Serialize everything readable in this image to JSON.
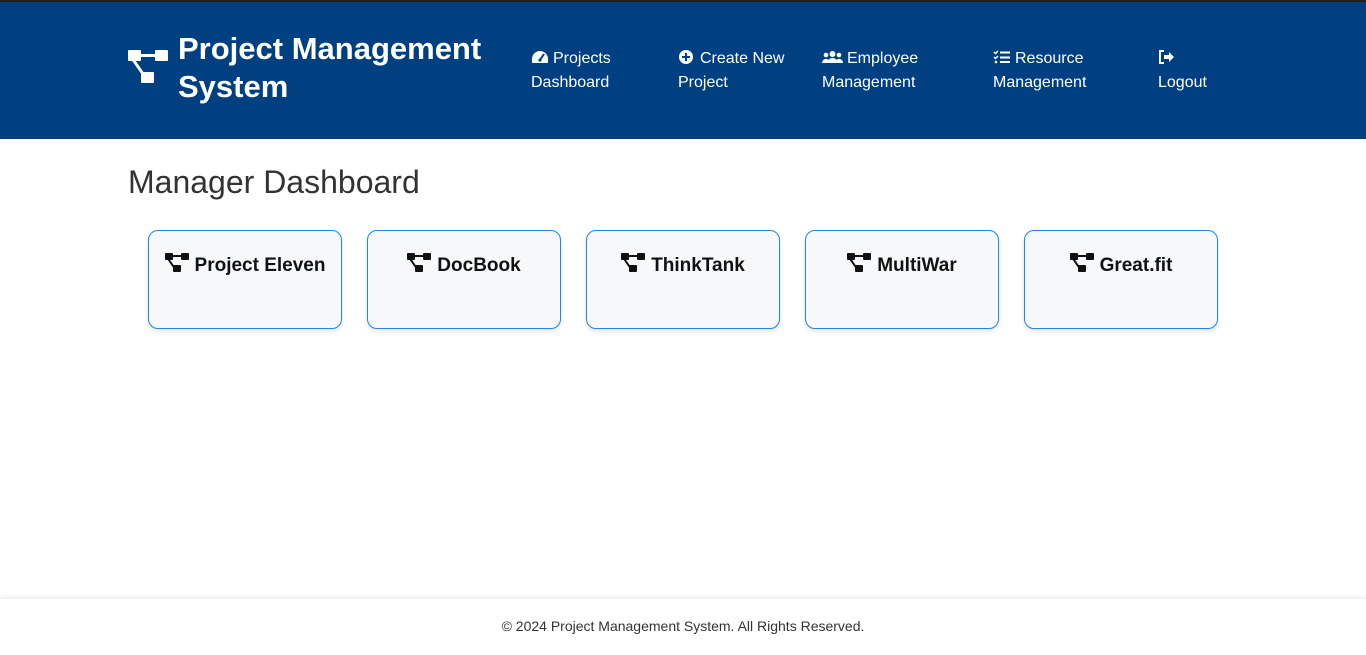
{
  "header": {
    "title": "Project Management System",
    "nav": [
      {
        "icon": "gauge-icon",
        "label_line1": "Projects",
        "label_line2": "Dashboard"
      },
      {
        "icon": "plus-circle-icon",
        "label_line1": "Create New",
        "label_line2": "Project"
      },
      {
        "icon": "users-icon",
        "label_line1": "Employee",
        "label_line2": "Management"
      },
      {
        "icon": "list-check-icon",
        "label_line1": "Resource",
        "label_line2": "Management"
      },
      {
        "icon": "logout-icon",
        "label_line1": "",
        "label_line2": "Logout"
      }
    ]
  },
  "main": {
    "title": "Manager Dashboard",
    "projects": [
      {
        "name": "Project Eleven",
        "icon": "project-diagram-icon"
      },
      {
        "name": "DocBook",
        "icon": "project-diagram-icon"
      },
      {
        "name": "ThinkTank",
        "icon": "project-diagram-icon"
      },
      {
        "name": "MultiWar",
        "icon": "project-diagram-icon"
      },
      {
        "name": "Great.fit",
        "icon": "project-diagram-icon"
      }
    ]
  },
  "footer": {
    "text": "© 2024 Project Management System. All Rights Reserved."
  },
  "colors": {
    "header_bg": "#004080",
    "card_border": "#1e88e5",
    "card_bg": "#f6f8fa"
  }
}
